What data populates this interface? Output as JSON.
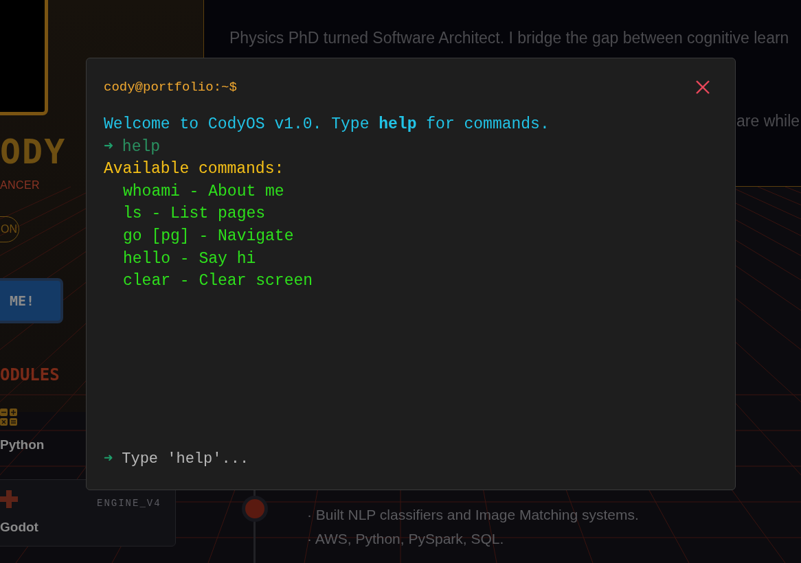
{
  "background": {
    "profile": {
      "name": "ODY",
      "role": "ANCER",
      "pill_button": "ON",
      "cta_button": "ME!"
    },
    "modules": {
      "title": "ODULES",
      "items": [
        {
          "kind": "calculator",
          "label": "Python"
        },
        {
          "kind": "gamepad",
          "label": "Godot"
        }
      ],
      "card_tag": "ENGINE_V4"
    },
    "bio": {
      "text": "Physics PhD turned Software Architect. I bridge the gap between cognitive learn",
      "text_2": "are while"
    },
    "timeline": {
      "bullets": [
        "· Built NLP classifiers and Image Matching systems.",
        "· AWS, Python, PySpark, SQL."
      ]
    }
  },
  "terminal": {
    "prompt": "cody@portfolio:~$",
    "lines": [
      {
        "kind": "info",
        "text": "Welcome to CodyOS v1.0. Type **help** for commands."
      },
      {
        "kind": "command",
        "arrow": "➜",
        "text": "help"
      },
      {
        "kind": "heading",
        "text": "Available commands:"
      },
      {
        "kind": "item",
        "text": "whoami - About me"
      },
      {
        "kind": "item",
        "text": "ls - List pages"
      },
      {
        "kind": "item",
        "text": "go [pg] - Navigate"
      },
      {
        "kind": "item",
        "text": "hello - Say hi"
      },
      {
        "kind": "item",
        "text": "clear - Clear screen"
      }
    ],
    "input": {
      "arrow": "➜",
      "placeholder": "Type 'help'..."
    }
  }
}
